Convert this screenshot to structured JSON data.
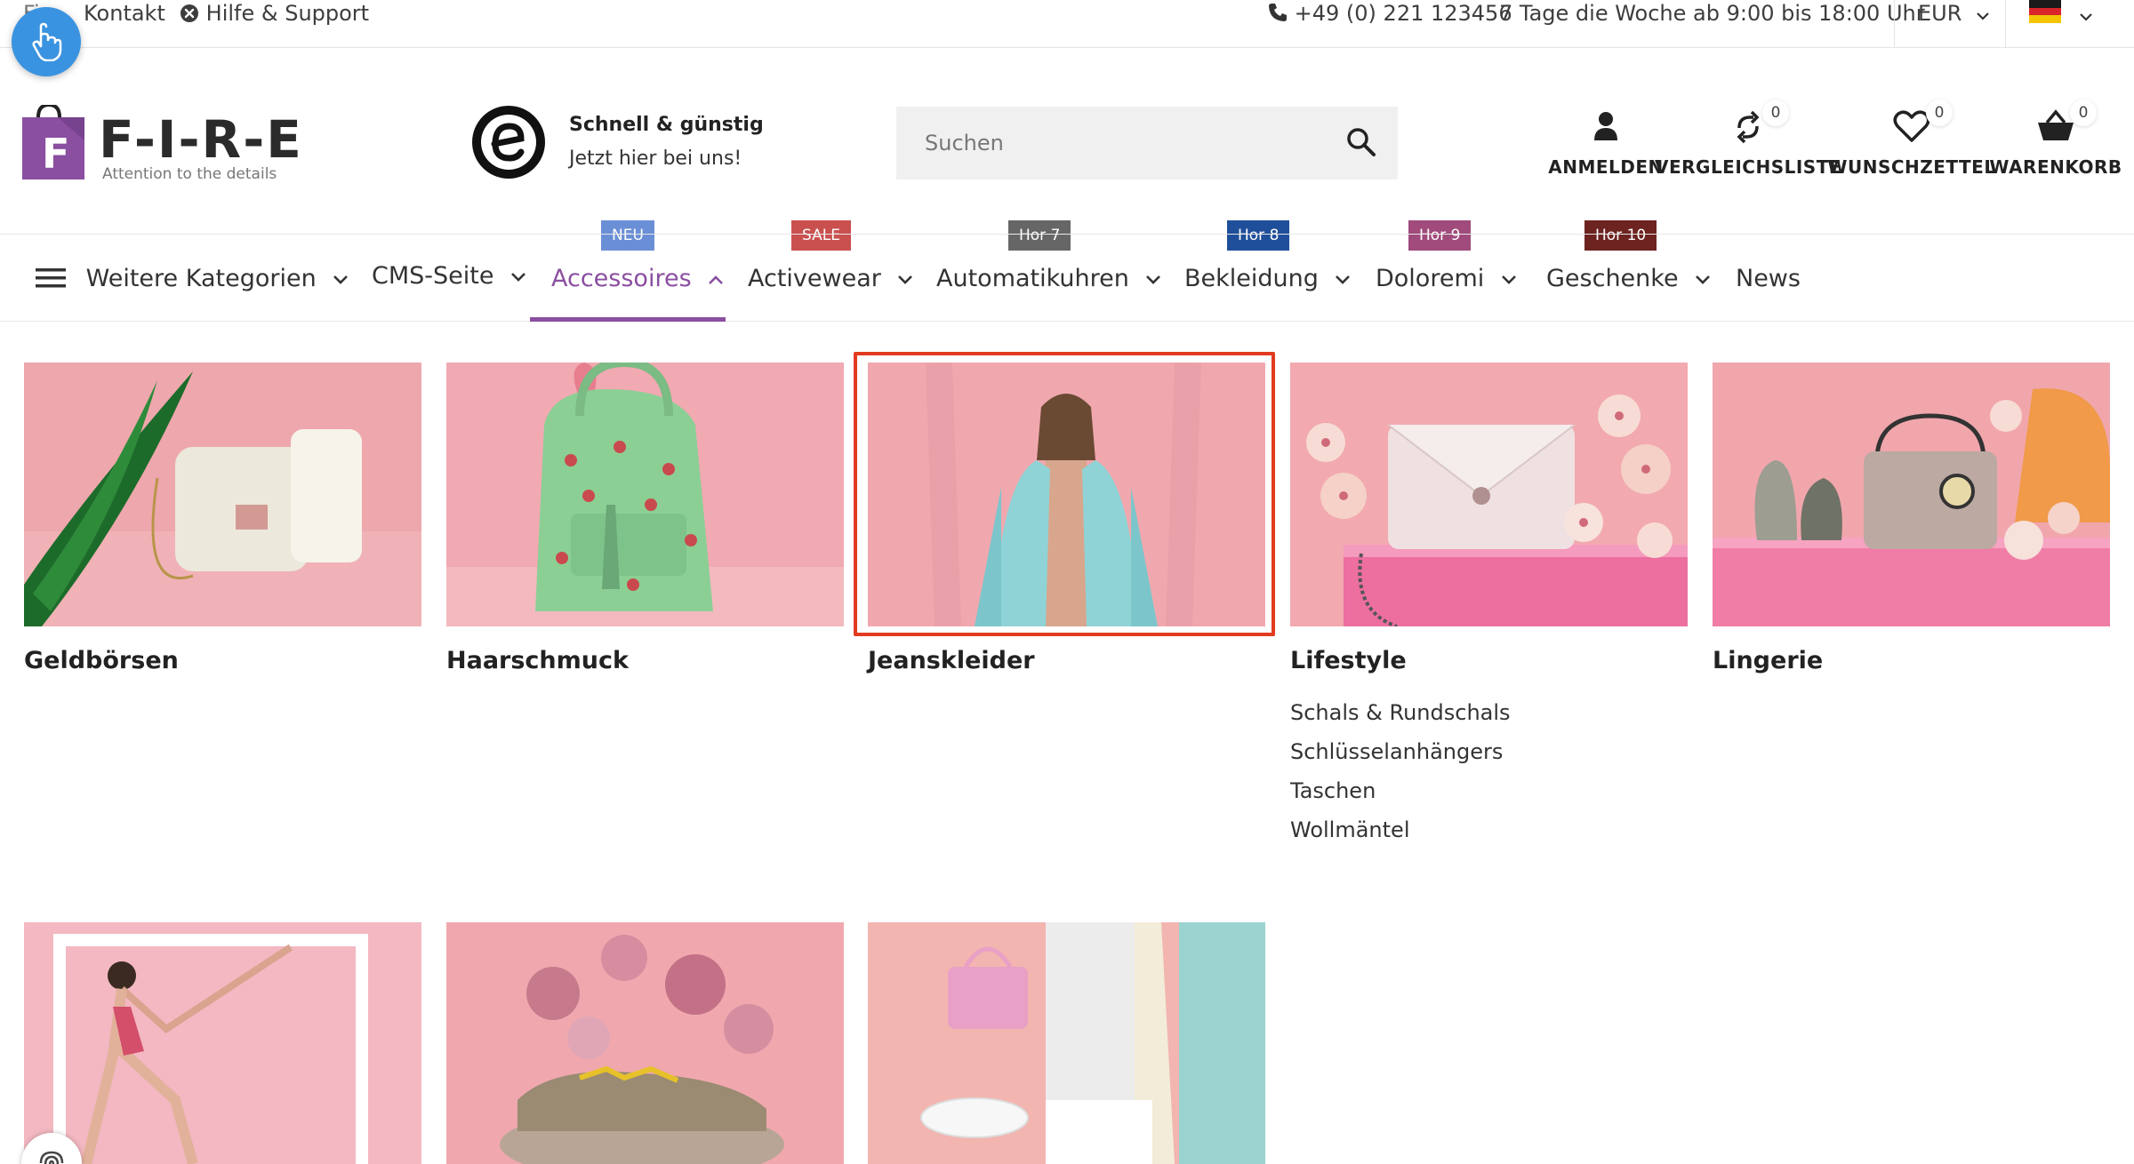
{
  "topbar": {
    "cut_link": "Fi...",
    "contact": "Kontakt",
    "help": "Hilfe & Support",
    "phone": "+49 (0) 221 123456",
    "hours": "7 Tage die Woche ab 9:00 bis 18:00 Uhr",
    "currency": "EUR"
  },
  "logo": {
    "letter": "F",
    "name": "F-I-R-E",
    "tagline": "Attention to the details"
  },
  "trust": {
    "title": "Schnell & günstig",
    "subtitle": "Jetzt hier bei uns!"
  },
  "search": {
    "placeholder": "Suchen"
  },
  "header_icons": [
    {
      "label": "ANMELDEN"
    },
    {
      "label": "VERGLEICHSLISTE",
      "count": "0"
    },
    {
      "label": "WUNSCHZETTEL",
      "count": "0"
    },
    {
      "label": "WARENKORB",
      "count": "0"
    }
  ],
  "nav": {
    "items": [
      {
        "label": "Weitere Kategorien"
      },
      {
        "label": "CMS-Seite"
      },
      {
        "label": "Accessoires",
        "tag": "NEU"
      },
      {
        "label": "Activewear",
        "tag": "SALE"
      },
      {
        "label": "Automatikuhren",
        "tag": "Hor 7"
      },
      {
        "label": "Bekleidung",
        "tag": "Hor 8"
      },
      {
        "label": "Doloremi",
        "tag": "Hor 9"
      },
      {
        "label": "Geschenke",
        "tag": "Hor 10"
      },
      {
        "label": "News"
      }
    ]
  },
  "categories": [
    {
      "name": "Geldbörsen"
    },
    {
      "name": "Haarschmuck"
    },
    {
      "name": "Jeanskleider"
    },
    {
      "name": "Lifestyle",
      "sub": [
        "Schals & Rundschals",
        "Schlüsselanhängers",
        "Taschen",
        "Wollmäntel"
      ]
    },
    {
      "name": "Lingerie"
    }
  ],
  "colors": {
    "accent": "#8a4fa0",
    "tag_neu": "#6b8fd6",
    "tag_sale": "#c9504f",
    "tag_hor7": "#666666",
    "tag_hor8": "#1f4f9a",
    "tag_hor9": "#a04b7c",
    "tag_hor10": "#6d2320",
    "highlight": "#e23b1f"
  }
}
